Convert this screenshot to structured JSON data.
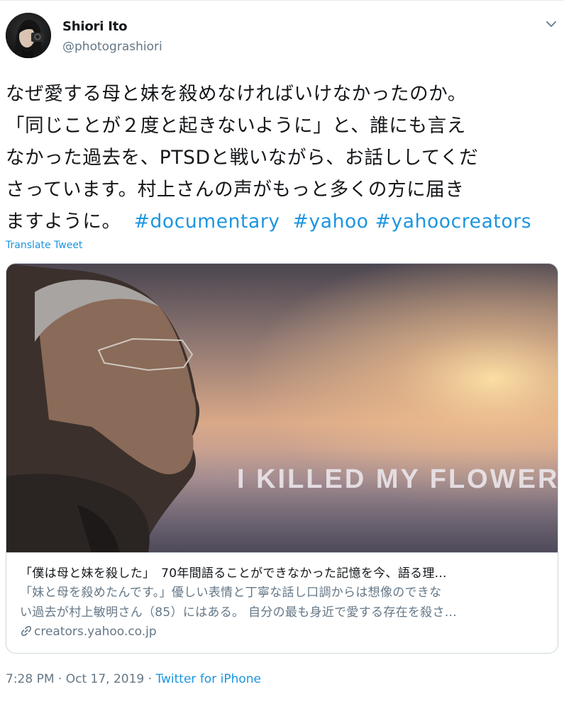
{
  "user": {
    "display_name": "Shiori Ito",
    "handle": "@photograshiori"
  },
  "tweet": {
    "line1": "なぜ愛する母と妹を殺めなければいけなかったのか。",
    "line2": "「同じことが２度と起きないように」と、誰にも言え",
    "line3": "なかった過去を、PTSDと戦いながら、お話ししてくだ",
    "line4": "さっています。村上さんの声がもっと多くの方に届き",
    "line5_text": "ますように。",
    "hashtags": [
      "#documentary",
      "#yahoo",
      "#yahoocreators"
    ],
    "translate_label": "Translate Tweet"
  },
  "card": {
    "image_overlay_text": "I KILLED MY FLOWERS",
    "title": "「僕は母と妹を殺した」　70年間語ることができなかった記憶を今、語る理...",
    "description_line1": "「妹と母を殺めたんです。」優しい表情と丁寧な話し口調からは想像のできな",
    "description_line2": "い過去が村上敏明さん（85）にはある。 自分の最も身近で愛する存在を殺さ...",
    "domain": "creators.yahoo.co.jp"
  },
  "meta": {
    "time": "7:28 PM",
    "separator": "·",
    "date": "Oct 17, 2019",
    "source": "Twitter for iPhone"
  },
  "icons": {
    "caret": "chevron-down-icon",
    "link": "link-icon"
  },
  "colors": {
    "link_blue": "#1b95e0",
    "secondary_text": "#657786",
    "border": "#ccd6dd"
  }
}
